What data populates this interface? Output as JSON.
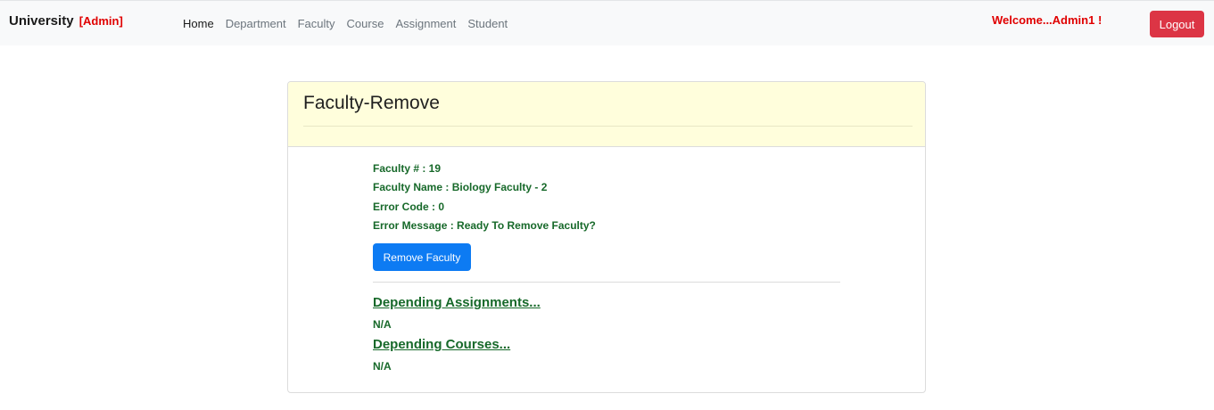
{
  "navbar": {
    "brand": "University",
    "role_badge": "[Admin]",
    "links": [
      "Home",
      "Department",
      "Faculty",
      "Course",
      "Assignment",
      "Student"
    ],
    "welcome": "Welcome...Admin1 !",
    "logout_label": "Logout"
  },
  "card": {
    "title": "Faculty-Remove",
    "faculty_number": "Faculty # : 19",
    "faculty_name": "Faculty Name : Biology Faculty - 2",
    "error_code": "Error Code : 0",
    "error_message": "Error Message : Ready To Remove Faculty?",
    "remove_button": "Remove Faculty",
    "depending_assignments": {
      "heading": "Depending Assignments...",
      "value": "N/A"
    },
    "depending_courses": {
      "heading": "Depending Courses...",
      "value": "N/A"
    }
  },
  "colors": {
    "navbar_bg": "#f8f9fa",
    "card_header_bg": "#fffedc",
    "info_text": "#17692a",
    "danger": "#dc3545",
    "primary": "#0d7bf3",
    "admin_red": "#e00000"
  }
}
